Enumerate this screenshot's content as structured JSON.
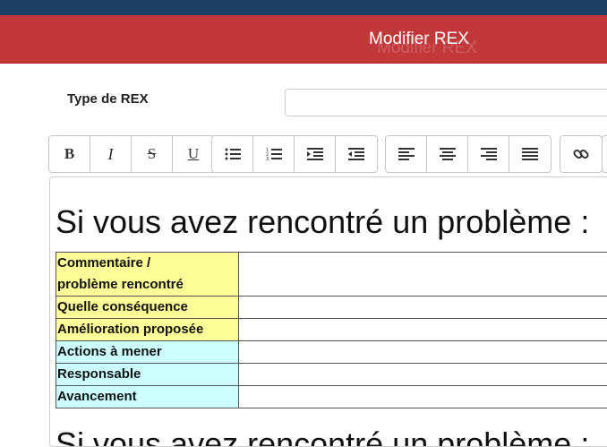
{
  "header": {
    "title": "Modifier REX"
  },
  "form": {
    "type_label": "Type de REX",
    "type_value": ""
  },
  "toolbar": {
    "groups": [
      [
        {
          "name": "bold-button",
          "label": "B",
          "icon": "bold-icon"
        },
        {
          "name": "italic-button",
          "label": "I",
          "icon": "italic-icon"
        },
        {
          "name": "strikethrough-button",
          "label": "S",
          "icon": "strikethrough-icon"
        },
        {
          "name": "underline-button",
          "label": "U",
          "icon": "underline-icon"
        }
      ],
      [
        {
          "name": "bulleted-list-button",
          "icon": "bulleted-list-icon"
        },
        {
          "name": "numbered-list-button",
          "icon": "numbered-list-icon"
        },
        {
          "name": "indent-button",
          "icon": "indent-icon"
        },
        {
          "name": "outdent-button",
          "icon": "outdent-icon"
        }
      ],
      [
        {
          "name": "align-left-button",
          "icon": "align-left-icon"
        },
        {
          "name": "align-center-button",
          "icon": "align-center-icon"
        },
        {
          "name": "align-right-button",
          "icon": "align-right-icon"
        },
        {
          "name": "align-justify-button",
          "icon": "align-justify-icon"
        }
      ],
      [
        {
          "name": "link-button",
          "icon": "link-icon"
        }
      ]
    ]
  },
  "editor": {
    "heading": "Si vous avez rencontré un problème :",
    "table": [
      {
        "label_lines": [
          "Commentaire /",
          "problème rencontré"
        ],
        "color": "#ffff99",
        "value": ""
      },
      {
        "label_lines": [
          "Quelle conséquence"
        ],
        "color": "#ffff99",
        "value": ""
      },
      {
        "label_lines": [
          "Amélioration proposée"
        ],
        "color": "#ffff99",
        "value": ""
      },
      {
        "label_lines": [
          "Actions à mener"
        ],
        "color": "#ccffff",
        "value": ""
      },
      {
        "label_lines": [
          "Responsable"
        ],
        "color": "#ccffff",
        "value": ""
      },
      {
        "label_lines": [
          "Avancement"
        ],
        "color": "#ccffff",
        "value": ""
      }
    ]
  }
}
